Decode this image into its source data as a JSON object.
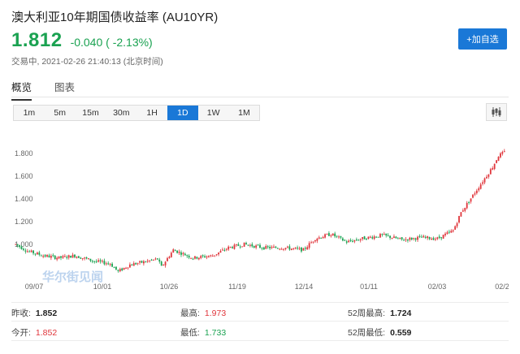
{
  "header": {
    "title": "澳大利亚10年期国债收益率  (AU10YR)",
    "price": "1.812",
    "change": "-0.040 ( -2.13%)",
    "status": "交易中,  2021-02-26 21:40:13  (北京时间)",
    "add_button": "+加自选"
  },
  "tabs": [
    {
      "label": "概览",
      "active": true
    },
    {
      "label": "图表",
      "active": false
    }
  ],
  "periods": [
    {
      "label": "1m"
    },
    {
      "label": "5m"
    },
    {
      "label": "15m"
    },
    {
      "label": "30m"
    },
    {
      "label": "1H"
    },
    {
      "label": "1D",
      "active": true
    },
    {
      "label": "1W"
    },
    {
      "label": "1M"
    }
  ],
  "watermark": "华尔街见闻",
  "chart_data": {
    "type": "candlestick",
    "y_ticks": [
      "1.800",
      "1.600",
      "1.400",
      "1.200",
      "1.000"
    ],
    "y_range": [
      0.72,
      1.95
    ],
    "x_ticks": [
      "09/07",
      "10/01",
      "10/26",
      "11/19",
      "12/14",
      "01/11",
      "02/03",
      "02/2"
    ],
    "last_value": 1.812,
    "up_color": "#e0353b",
    "down_color": "#1aa251",
    "grid": false
  },
  "stats": {
    "rows": [
      [
        {
          "label": "昨收:",
          "value": "1.852",
          "tone": "plain"
        },
        {
          "label": "最高:",
          "value": "1.973",
          "tone": "red"
        },
        {
          "label": "52周最高:",
          "value": "1.724",
          "tone": "plain"
        }
      ],
      [
        {
          "label": "今开:",
          "value": "1.852",
          "tone": "red"
        },
        {
          "label": "最低:",
          "value": "1.733",
          "tone": "green"
        },
        {
          "label": "52周最低:",
          "value": "0.559",
          "tone": "plain"
        }
      ]
    ]
  }
}
